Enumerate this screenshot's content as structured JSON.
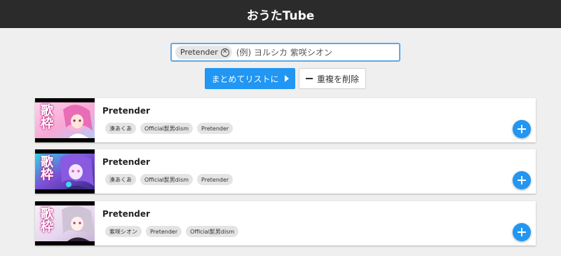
{
  "header": {
    "title": "おうたTube"
  },
  "search": {
    "chip_label": "Pretender",
    "placeholder": "(例) ヨルシカ 紫咲シオン",
    "value": ""
  },
  "actions": {
    "list_button_label": "まとめてリストに",
    "dedupe_button_label": "重複を削除"
  },
  "videos": [
    {
      "title": "Pretender",
      "thumb_text": "歌枠",
      "tags": [
        "湊あくあ",
        "Official髭男dism",
        "Pretender"
      ]
    },
    {
      "title": "Pretender",
      "thumb_text": "歌枠",
      "tags": [
        "湊あくあ",
        "Official髭男dism",
        "Pretender"
      ]
    },
    {
      "title": "Pretender",
      "thumb_text": "歌枠",
      "tags": [
        "紫咲シオン",
        "Pretender",
        "Official髭男dism"
      ]
    }
  ],
  "colors": {
    "header_bg": "#2b2b2b",
    "accent": "#2196f3",
    "search_border": "#5fa8e6"
  }
}
